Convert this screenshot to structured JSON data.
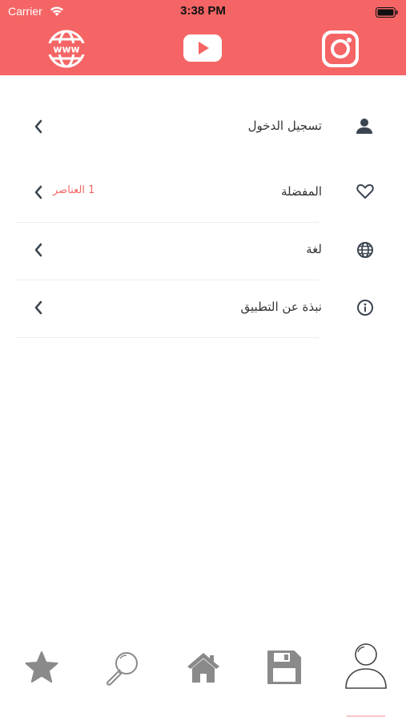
{
  "status_bar": {
    "carrier": "Carrier",
    "time": "3:38 PM"
  },
  "header": {
    "background": "#f56565",
    "links": [
      {
        "name": "website",
        "icon": "www-globe-icon"
      },
      {
        "name": "youtube",
        "icon": "youtube-icon"
      },
      {
        "name": "instagram",
        "icon": "instagram-icon"
      }
    ]
  },
  "menu": {
    "items": [
      {
        "icon": "person-icon",
        "label": "تسجيل الدخول",
        "badge": ""
      },
      {
        "icon": "heart-icon",
        "label": "المفضلة",
        "badge": "1 العناصر"
      },
      {
        "icon": "globe-icon",
        "label": "لغة",
        "badge": ""
      },
      {
        "icon": "info-icon",
        "label": "نبذة عن التطبيق",
        "badge": ""
      }
    ]
  },
  "tabbar": {
    "tabs": [
      {
        "icon": "star-icon"
      },
      {
        "icon": "search-icon"
      },
      {
        "icon": "home-icon"
      },
      {
        "icon": "save-icon"
      },
      {
        "icon": "profile-icon",
        "selected": true
      }
    ],
    "accent": "#f56565"
  }
}
